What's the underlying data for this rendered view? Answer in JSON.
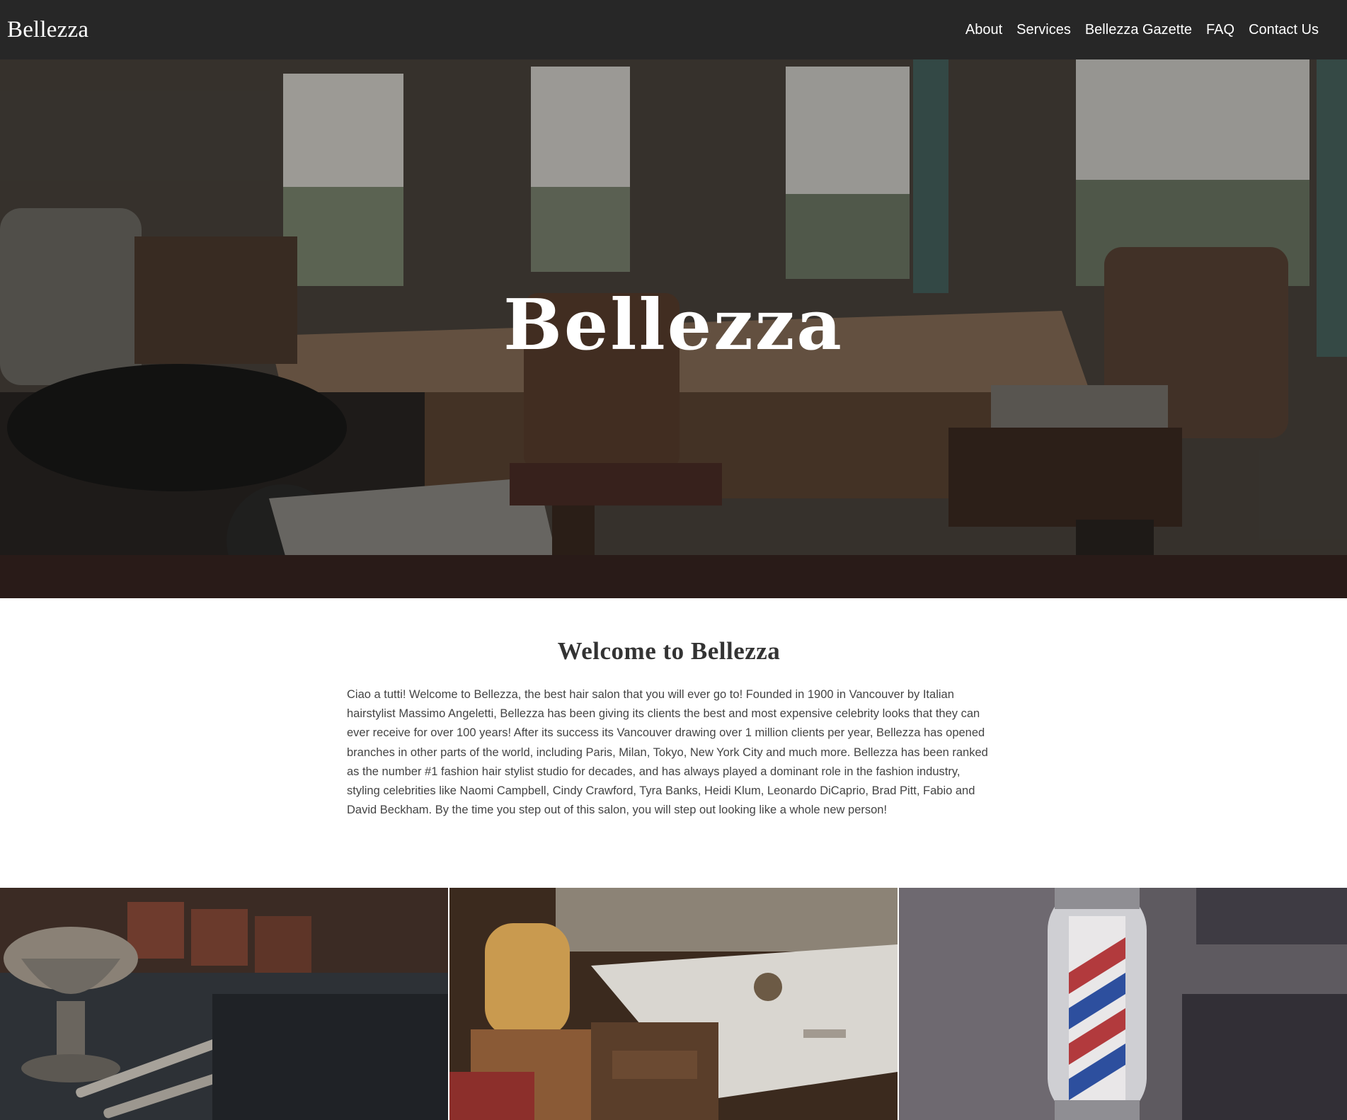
{
  "nav": {
    "brand": "Bellezza",
    "links": [
      "About",
      "Services",
      "Bellezza Gazette",
      "FAQ",
      "Contact Us"
    ]
  },
  "hero": {
    "title": "Bellezza"
  },
  "welcome": {
    "title": "Welcome to Bellezza",
    "text": "Ciao a tutti! Welcome to Bellezza, the best hair salon that you will ever go to! Founded in 1900 in Vancouver by Italian hairstylist Massimo Angeletti, Bellezza has been giving its clients the best and most expensive celebrity looks that they can ever receive for over 100 years! After its success its Vancouver drawing over 1 million clients per year, Bellezza has opened branches in other parts of the world, including Paris, Milan, Tokyo, New York City and much more. Bellezza has been ranked as the number #1 fashion hair stylist studio for decades, and has always played a dominant role in the fashion industry, styling celebrities like Naomi Campbell, Cindy Crawford, Tyra Banks, Heidi Klum, Leonardo DiCaprio, Brad Pitt, Fabio and David Beckham. By the time you step out of this salon, you will step out looking like a whole new person!"
  },
  "colors": {
    "navbar_bg": "#272727",
    "text_dark": "#333333"
  }
}
